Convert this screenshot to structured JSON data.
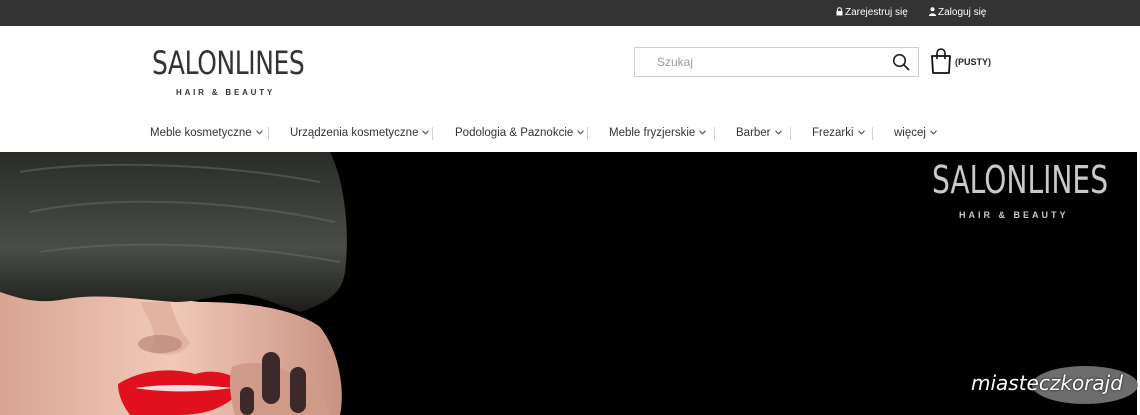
{
  "topbar": {
    "register_label": "Zarejestruj się",
    "login_label": "Zaloguj się",
    "background": "#333333",
    "icons": {
      "register": "lock-icon",
      "login": "user-icon"
    }
  },
  "header": {
    "logo_text": "SALONLINES",
    "logo_tagline": "HAIR & BEAUTY",
    "search_placeholder": "Szukaj",
    "search_value": "",
    "cart_label": "(PUSTY)",
    "icons": {
      "search": "search-icon",
      "cart": "shopping-bag-icon"
    }
  },
  "nav": {
    "items": [
      {
        "label": "Meble kosmetyczne"
      },
      {
        "label": "Urządzenia kosmetyczne"
      },
      {
        "label": "Podologia & Paznokcie"
      },
      {
        "label": "Meble fryzjerskie"
      },
      {
        "label": "Barber"
      },
      {
        "label": "Frezarki"
      },
      {
        "label": "więcej"
      }
    ],
    "dropdown_icon": "chevron-down-icon"
  },
  "hero": {
    "logo_text": "SALONLINES",
    "logo_tagline": "HAIR & BEAUTY",
    "watermark": "miasteczkorajd",
    "colors": {
      "background": "#000000",
      "lips": "#e0101e",
      "hair": "#3a3d38"
    }
  }
}
